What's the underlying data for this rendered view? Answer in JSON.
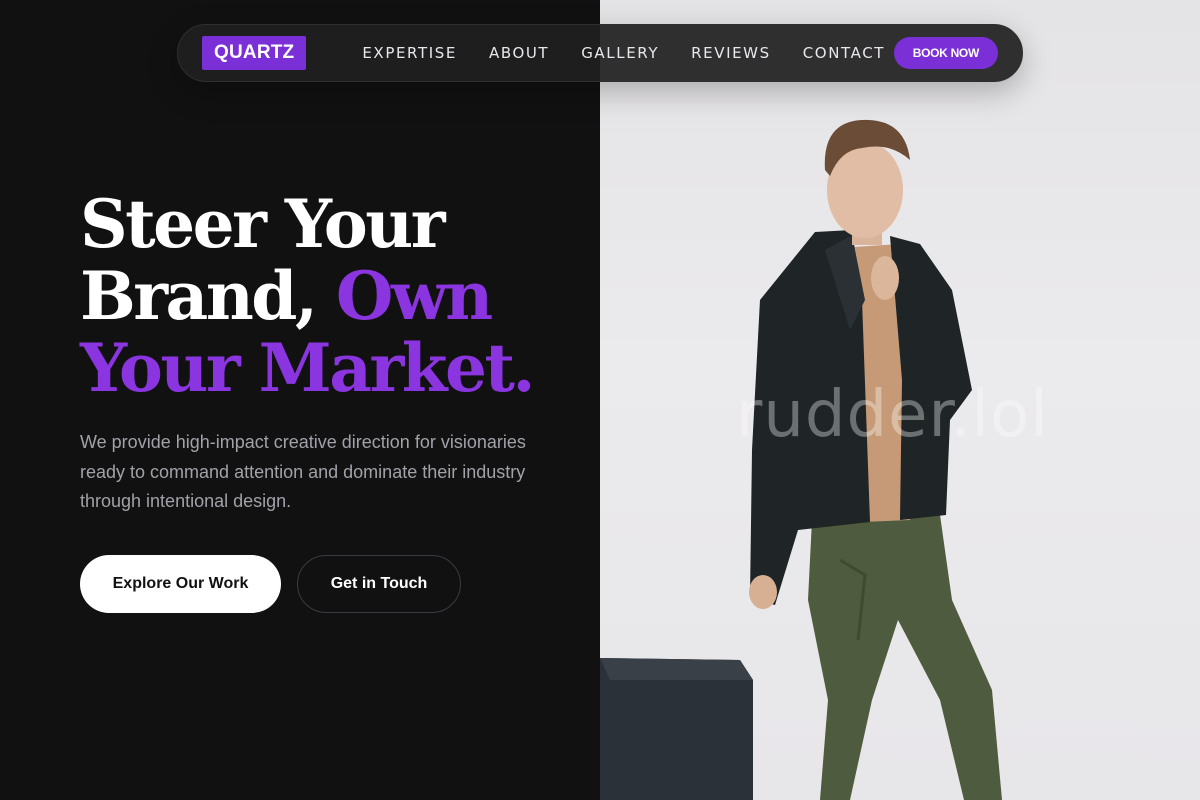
{
  "nav": {
    "logo": "QUARTZ",
    "links": [
      "EXPERTISE",
      "ABOUT",
      "GALLERY",
      "REVIEWS",
      "CONTACT"
    ],
    "cta": "BOOK NOW"
  },
  "hero": {
    "title_line1": "Steer Your",
    "title_line2_white": "Brand, ",
    "title_line2_accent": "Own",
    "title_line3_accent": "Your Market.",
    "subtitle": "We provide high-impact creative direction for visionaries ready to command attention and dominate their industry through intentional design.",
    "primary_button": "Explore Our Work",
    "secondary_button": "Get in Touch"
  },
  "photo": {
    "watermark": "rudder.lol"
  },
  "colors": {
    "accent": "#7b2fd6",
    "background": "#121112",
    "photo_background": "#e8e7ea"
  }
}
